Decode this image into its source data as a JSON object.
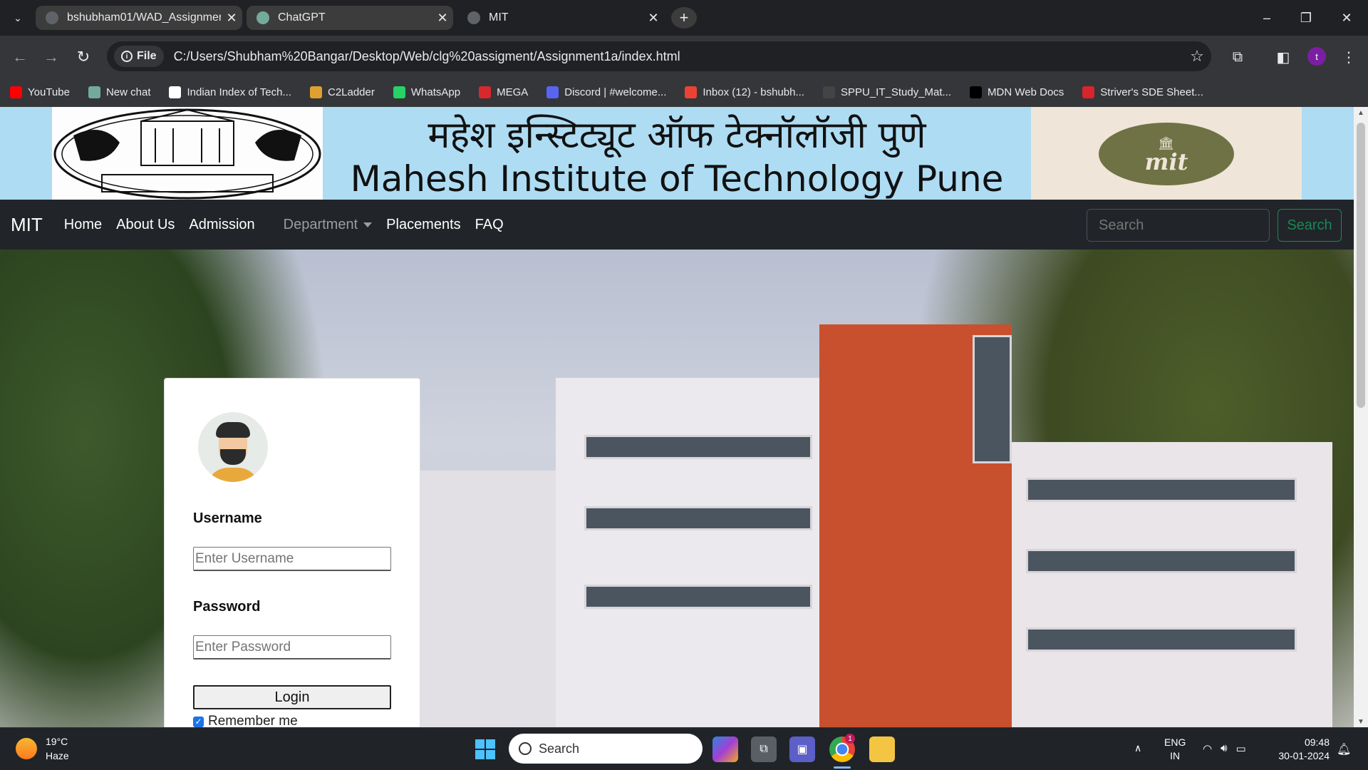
{
  "browser": {
    "tabs": [
      {
        "title": "bshubham01/WAD_Assignment",
        "icon": "github-icon",
        "active": false
      },
      {
        "title": "ChatGPT",
        "icon": "chatgpt-icon",
        "active": false
      },
      {
        "title": "MIT",
        "icon": "globe-icon",
        "active": true
      }
    ],
    "url_scheme": "File",
    "url": "C:/Users/Shubham%20Bangar/Desktop/Web/clg%20assigment/Assignment1a/index.html",
    "profile_initial": "t",
    "bookmarks": [
      {
        "label": "YouTube",
        "icon": "youtube-icon",
        "color": "#ff0000"
      },
      {
        "label": "New chat",
        "icon": "chatgpt-icon",
        "color": "#74aa9c"
      },
      {
        "label": "Indian Index of Tech...",
        "icon": "document-icon",
        "color": "#ffffff"
      },
      {
        "label": "C2Ladder",
        "icon": "chart-icon",
        "color": "#e0a030"
      },
      {
        "label": "WhatsApp",
        "icon": "whatsapp-icon",
        "color": "#25d366"
      },
      {
        "label": "MEGA",
        "icon": "mega-icon",
        "color": "#d9272e"
      },
      {
        "label": "Discord | #welcome...",
        "icon": "discord-icon",
        "color": "#5865f2"
      },
      {
        "label": "Inbox (12) - bshubh...",
        "icon": "gmail-icon",
        "color": "#ea4335"
      },
      {
        "label": "SPPU_IT_Study_Mat...",
        "icon": "github-icon",
        "color": "#444444"
      },
      {
        "label": "MDN Web Docs",
        "icon": "mdn-icon",
        "color": "#000000"
      },
      {
        "label": "Striver's SDE Sheet...",
        "icon": "tuf-icon",
        "color": "#d7262b"
      }
    ]
  },
  "site": {
    "banner_hindi": "महेश इन्स्टिट्यूट ऑफ टेक्नॉलॉजी पुणे",
    "banner_title": "Mahesh Institute of Technology Pune",
    "brand_logo_text": "mit",
    "nav": {
      "brand": "MIT",
      "links": [
        "Home",
        "About Us",
        "Admission"
      ],
      "dropdown": "Department",
      "links_after": [
        "Placements",
        "FAQ"
      ],
      "search_placeholder": "Search",
      "search_button": "Search"
    },
    "login": {
      "username_label": "Username",
      "username_placeholder": "Enter Username",
      "password_label": "Password",
      "password_placeholder": "Enter Password",
      "login_button": "Login",
      "remember_label": "Remember me",
      "remember_checked": true
    }
  },
  "taskbar": {
    "weather_temp": "19°C",
    "weather_condition": "Haze",
    "search_label": "Search",
    "lang_top": "ENG",
    "lang_bottom": "IN",
    "time": "09:48",
    "date": "30-01-2024",
    "chrome_badge": "1"
  }
}
